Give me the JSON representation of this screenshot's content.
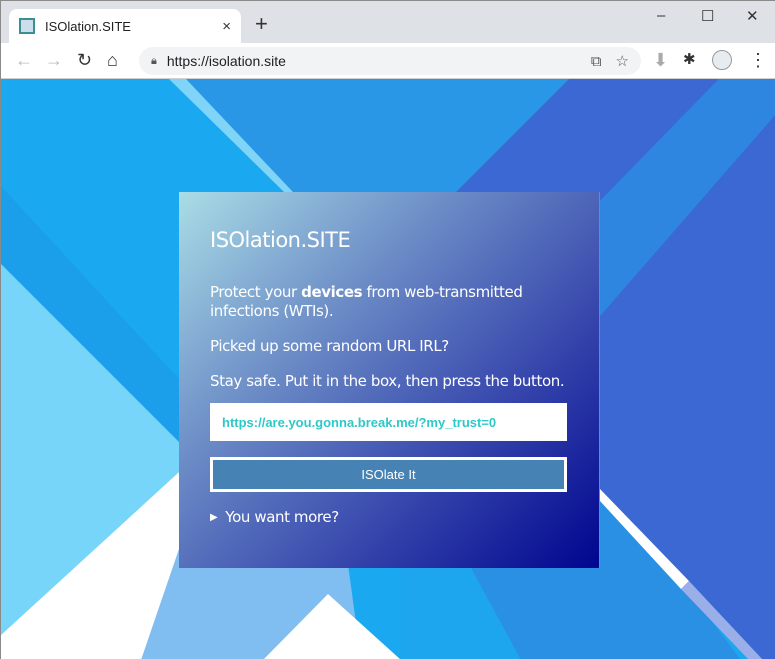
{
  "browser": {
    "tab_title": "ISOlation.SITE",
    "tab_close": "×",
    "new_tab": "+",
    "url": "https://isolation.site",
    "window_controls": {
      "minimize": "–",
      "maximize": "☐",
      "close": "✕"
    },
    "icons": [
      "back-icon",
      "forward-icon",
      "reload-icon",
      "home-icon",
      "lock-icon",
      "translate-icon",
      "star-icon",
      "download-icon",
      "extensions-icon",
      "profile-icon",
      "menu-icon"
    ]
  },
  "page": {
    "title": "ISOlation.SITE",
    "intro_pre": "Protect your ",
    "intro_bold": "devices",
    "intro_post": " from web-transmitted infections (WTIs).",
    "question": "Picked up some random URL IRL?",
    "instruction": "Stay safe. Put it in the box, then press the button.",
    "url_input_value": "https://are.you.gonna.break.me/?my_trust=0",
    "button_label": "ISOlate It",
    "more_label": "You want more?"
  },
  "colors": {
    "button": "#4682b4",
    "input_text": "#2ec8c8",
    "card_gradient_end": "#00058f"
  }
}
